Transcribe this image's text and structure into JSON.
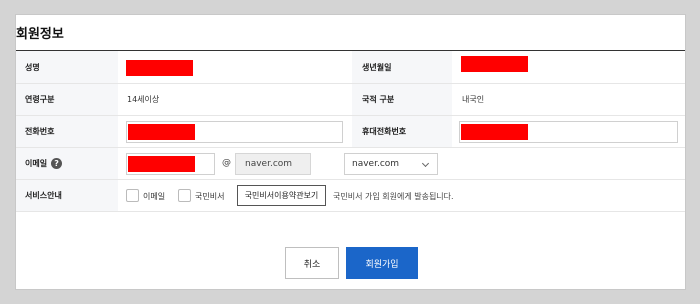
{
  "section_title": "회원정보",
  "fields": {
    "name_label": "성명",
    "birthdate_label": "생년월일",
    "age_group_label": "연령구분",
    "age_group_value": "14세이상",
    "nationality_label": "국적 구분",
    "nationality_value": "내국인",
    "phone_label": "전화번호",
    "mobile_label": "휴대전화번호",
    "email_label": "이메일",
    "email_help": "?",
    "email_at": "@",
    "email_domain_value": "naver.com",
    "email_domain_select": "naver.com",
    "service_label": "서비스안내",
    "service_email_option": "이메일",
    "service_citizen_option": "국민비서",
    "tos_button": "국민비서이용약관보기",
    "service_note": "국민비서 가입 회원에게 발송됩니다."
  },
  "buttons": {
    "cancel": "취소",
    "join": "회원가입"
  },
  "colors": {
    "redaction": "#ff0000",
    "primary": "#1b66c9"
  }
}
